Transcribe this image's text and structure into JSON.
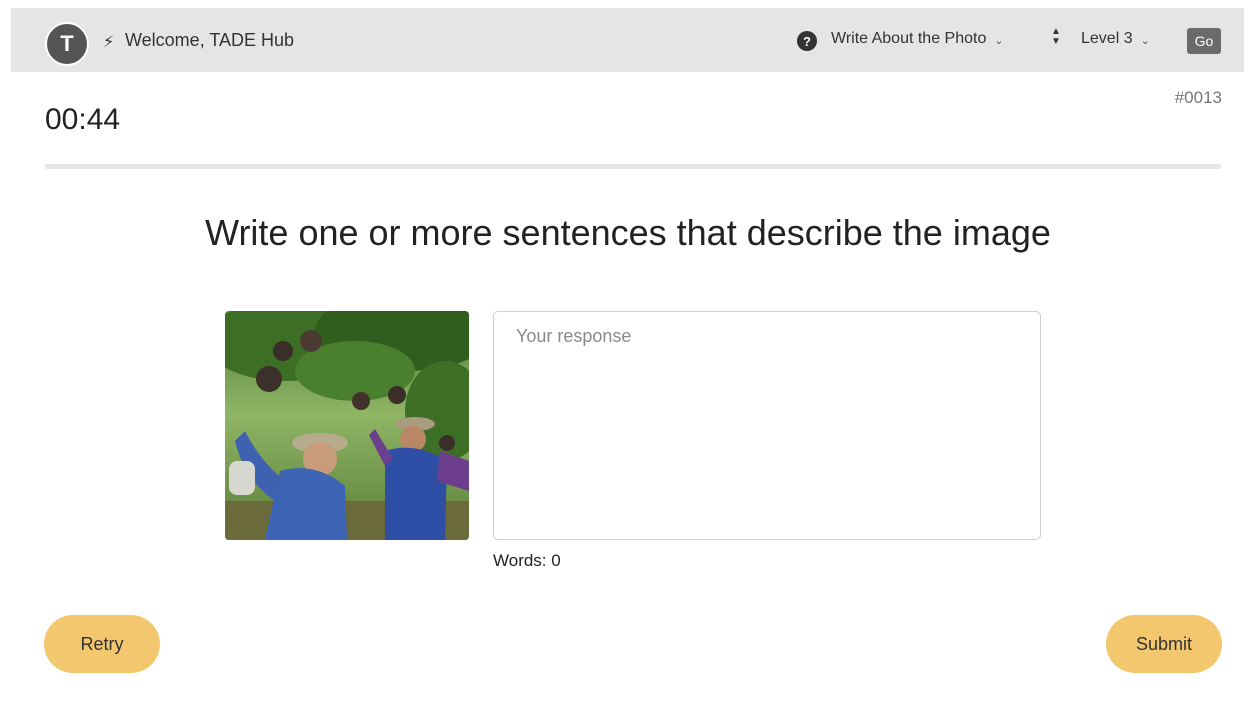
{
  "header": {
    "avatar_initial": "T",
    "welcome_text": "Welcome, TADE Hub",
    "task_label": "Write About the Photo",
    "level_label": "Level 3",
    "go_label": "Go"
  },
  "timer": "00:44",
  "question_id": "#0013",
  "prompt": "Write one or more sentences that describe the image",
  "response": {
    "placeholder": "Your response",
    "value": ""
  },
  "word_count_label": "Words: 0",
  "buttons": {
    "retry": "Retry",
    "submit": "Submit"
  },
  "colors": {
    "header_bg": "#e5e5e5",
    "button_accent": "#f3c76d",
    "go_button": "#6b6b6b"
  },
  "icons": {
    "bolt": "bolt-icon",
    "help": "question-circle-icon",
    "sort": "up-down-icon",
    "chevron": "chevron-down-icon"
  }
}
